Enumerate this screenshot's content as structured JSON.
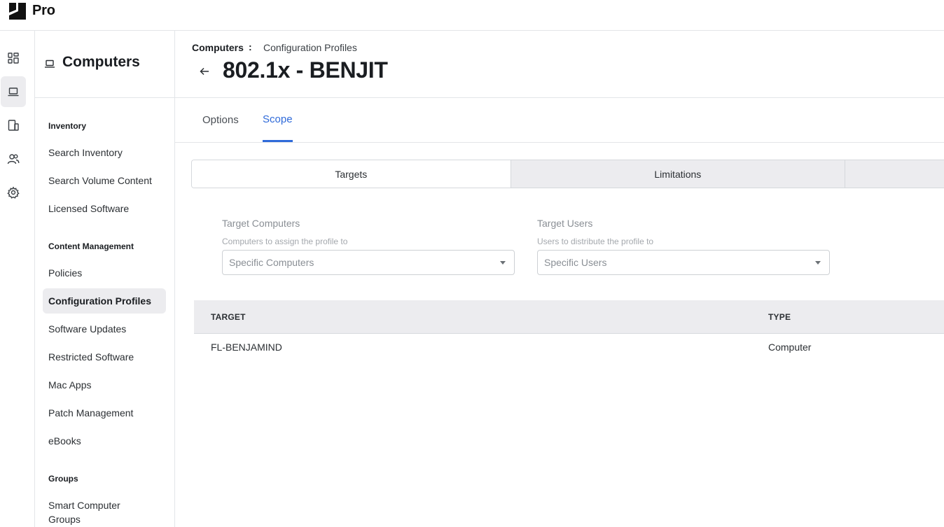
{
  "app": {
    "brand": "Pro"
  },
  "rail": {
    "items": [
      {
        "icon": "dashboard-icon",
        "active": false
      },
      {
        "icon": "laptop-icon",
        "active": true
      },
      {
        "icon": "devices-icon",
        "active": false
      },
      {
        "icon": "users-icon",
        "active": false
      },
      {
        "icon": "gear-icon",
        "active": false
      }
    ]
  },
  "sidebar": {
    "title": "Computers",
    "title_icon": "laptop-icon",
    "groups": [
      {
        "label": "Inventory",
        "items": [
          "Search Inventory",
          "Search Volume Content",
          "Licensed Software"
        ]
      },
      {
        "label": "Content Management",
        "items": [
          "Policies",
          "Configuration Profiles",
          "Software Updates",
          "Restricted Software",
          "Mac Apps",
          "Patch Management",
          "eBooks"
        ]
      },
      {
        "label": "Groups",
        "items": [
          "Smart Computer Groups"
        ]
      }
    ],
    "active_item": "Configuration Profiles"
  },
  "breadcrumb": {
    "root": "Computers",
    "separator": ":",
    "page": "Configuration Profiles"
  },
  "page": {
    "title": "802.1x - BENJIT"
  },
  "tabs": {
    "items": [
      "Options",
      "Scope"
    ],
    "active": "Scope"
  },
  "scope": {
    "segments": [
      "Targets",
      "Limitations",
      ""
    ],
    "active_segment": "Targets",
    "target_computers": {
      "label": "Target Computers",
      "help": "Computers to assign the profile to",
      "value": "Specific Computers"
    },
    "target_users": {
      "label": "Target Users",
      "help": "Users to distribute the profile to",
      "value": "Specific Users"
    }
  },
  "table": {
    "columns": [
      "TARGET",
      "TYPE"
    ],
    "rows": [
      {
        "target": "FL-BENJAMIND",
        "type": "Computer"
      }
    ]
  },
  "colors": {
    "accent": "#2f6ad9",
    "active_bg": "#ececef",
    "border": "#e3e5e8"
  }
}
